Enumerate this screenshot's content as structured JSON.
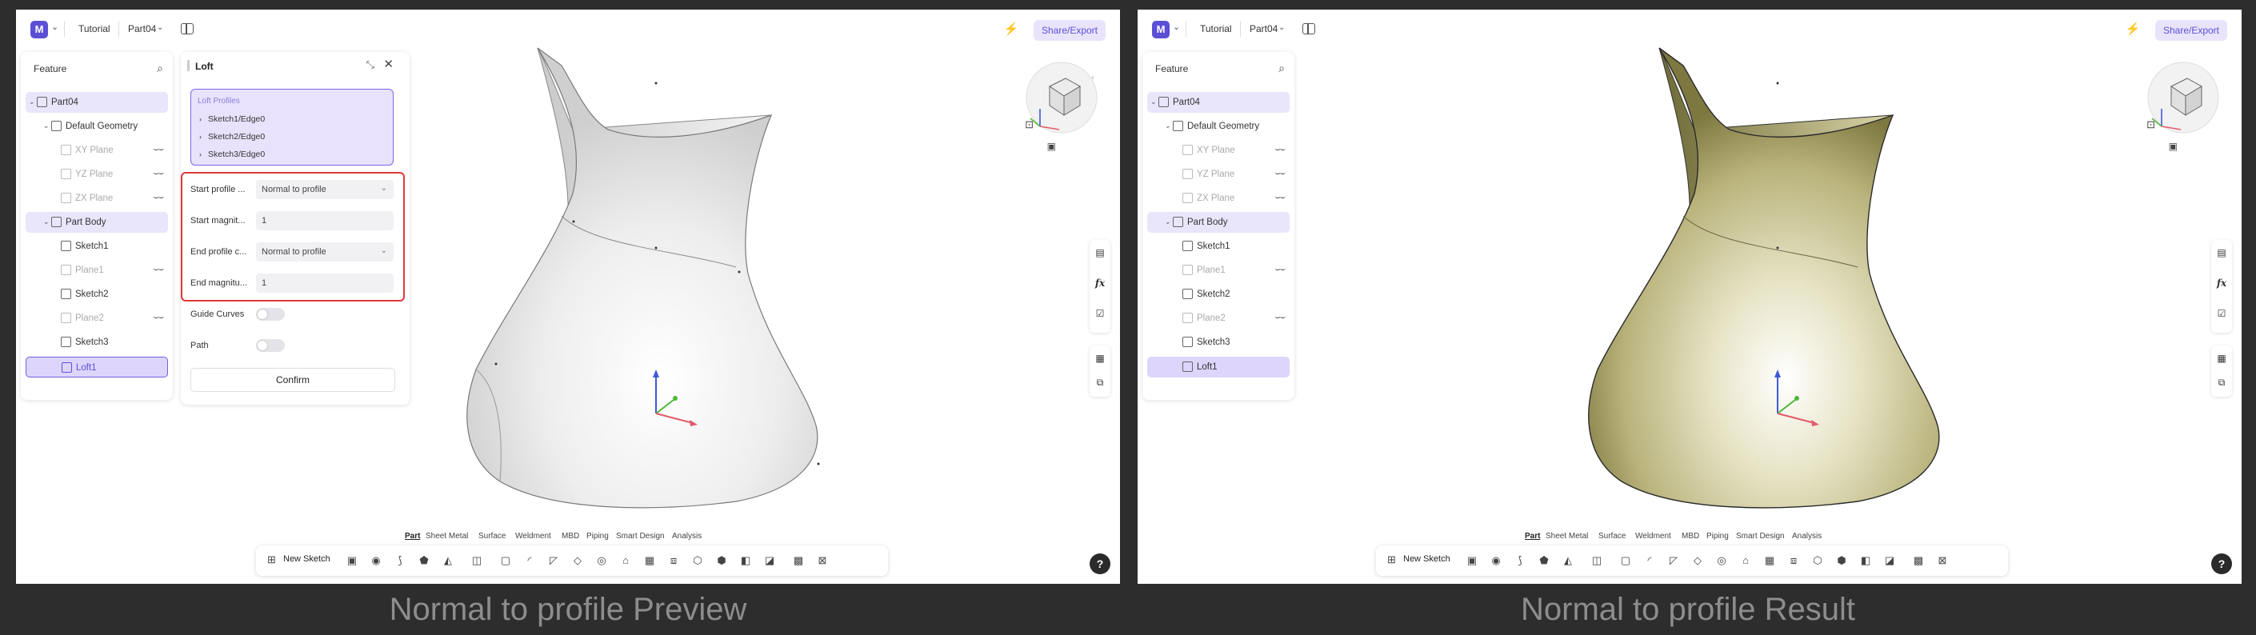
{
  "captions": {
    "left": "Normal to profile  Preview",
    "right": "Normal to profile  Result"
  },
  "topbar": {
    "logo": "M",
    "breadcrumb_tutorial": "Tutorial",
    "breadcrumb_part": "Part04",
    "share_label": "Share/Export",
    "ai_label": "⚡"
  },
  "tree": {
    "title": "Feature",
    "items": [
      {
        "label": "Part04",
        "level": 0,
        "arrow": "⌄",
        "dim": false,
        "eye": false
      },
      {
        "label": "Default Geometry",
        "level": 1,
        "arrow": "⌄",
        "dim": false,
        "eye": false
      },
      {
        "label": "XY Plane",
        "level": 2,
        "arrow": "",
        "dim": true,
        "eye": true
      },
      {
        "label": "YZ Plane",
        "level": 2,
        "arrow": "",
        "dim": true,
        "eye": true
      },
      {
        "label": "ZX Plane",
        "level": 2,
        "arrow": "",
        "dim": true,
        "eye": true
      },
      {
        "label": "Part Body",
        "level": 1,
        "arrow": "⌄",
        "dim": false,
        "eye": false
      },
      {
        "label": "Sketch1",
        "level": 2,
        "arrow": "",
        "dim": false,
        "eye": false
      },
      {
        "label": "Plane1",
        "level": 2,
        "arrow": "",
        "dim": true,
        "eye": true
      },
      {
        "label": "Sketch2",
        "level": 2,
        "arrow": "",
        "dim": false,
        "eye": false
      },
      {
        "label": "Plane2",
        "level": 2,
        "arrow": "",
        "dim": true,
        "eye": true
      },
      {
        "label": "Sketch3",
        "level": 2,
        "arrow": "",
        "dim": false,
        "eye": false
      },
      {
        "label": "Loft1",
        "level": 2,
        "arrow": "",
        "dim": false,
        "eye": false
      }
    ]
  },
  "loft": {
    "title": "Loft",
    "profiles_header": "Loft Profiles",
    "profiles": [
      "Sketch1/Edge0",
      "Sketch2/Edge0",
      "Sketch3/Edge0"
    ],
    "start_profile_label": "Start profile ...",
    "start_profile_value": "Normal to profile",
    "start_magnitude_label": "Start magnit...",
    "start_magnitude_value": "1",
    "end_profile_label": "End profile c...",
    "end_profile_value": "Normal to profile",
    "end_magnitude_label": "End magnitu...",
    "end_magnitude_value": "1",
    "guide_curves_label": "Guide Curves",
    "path_label": "Path",
    "confirm_label": "Confirm"
  },
  "tabs": [
    "Part",
    "Sheet Metal",
    "Surface",
    "Weldment",
    "MBD",
    "Piping",
    "Smart Design",
    "Analysis"
  ],
  "toolbar": {
    "new_sketch": "New Sketch"
  },
  "help": "?",
  "colors": {
    "accent": "#5b4fd6",
    "highlight": "#e9e5fb",
    "annotation_red": "#e0383a",
    "result_surface": "#c9c48e",
    "preview_surface": "#e9e9e9"
  }
}
